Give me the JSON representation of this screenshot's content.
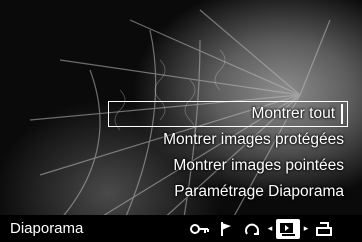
{
  "menu": {
    "items": [
      {
        "label": "Montrer tout"
      },
      {
        "label": "Montrer images protégées"
      },
      {
        "label": "Montrer images pointées"
      },
      {
        "label": "Paramétrage Diaporama"
      }
    ]
  },
  "status_bar": {
    "mode_label": "Diaporama",
    "icons": [
      "key-icon",
      "flag-icon",
      "rotate-icon",
      "slideshow-icon",
      "print-icon"
    ],
    "active_icon": "slideshow-icon"
  }
}
